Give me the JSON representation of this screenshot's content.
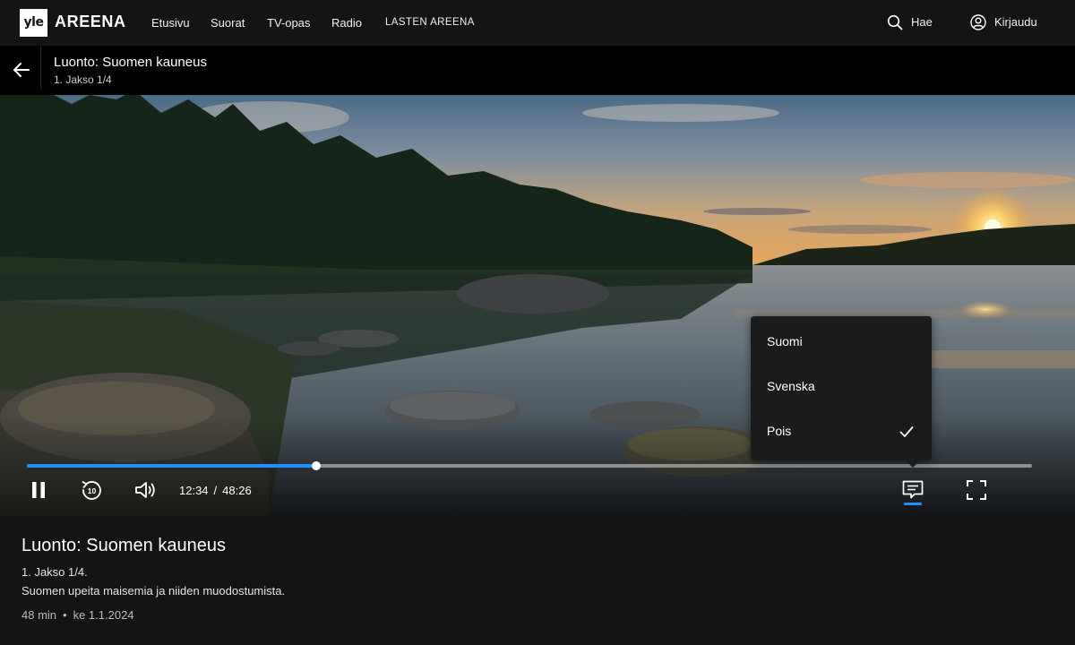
{
  "nav": {
    "logo_mark": "yle",
    "logo_text": "AREENA",
    "items": [
      "Etusivu",
      "Suorat",
      "TV-opas",
      "Radio",
      "LASTEN AREENA"
    ],
    "search_label": "Hae",
    "login_label": "Kirjaudu"
  },
  "titlebar": {
    "title": "Luonto: Suomen kauneus",
    "subtitle": "1. Jakso 1/4"
  },
  "player": {
    "current_time": "12:34",
    "separator": "/",
    "duration": "48:26",
    "progress_fraction": 0.2876,
    "accent_color": "#1e90ff",
    "state": "playing",
    "skip_back_seconds": "10",
    "icons": [
      "pause-icon",
      "replay-10-icon",
      "volume-icon",
      "subtitles-icon",
      "fullscreen-icon"
    ]
  },
  "subtitle_menu": {
    "options": [
      "Suomi",
      "Svenska",
      "Pois"
    ],
    "selected": "Pois"
  },
  "info": {
    "title": "Luonto: Suomen kauneus",
    "episode": "1. Jakso 1/4.",
    "description": "Suomen upeita maisemia ja niiden muodostumista.",
    "length": "48 min",
    "bullet": "•",
    "date": "ke 1.1.2024"
  }
}
